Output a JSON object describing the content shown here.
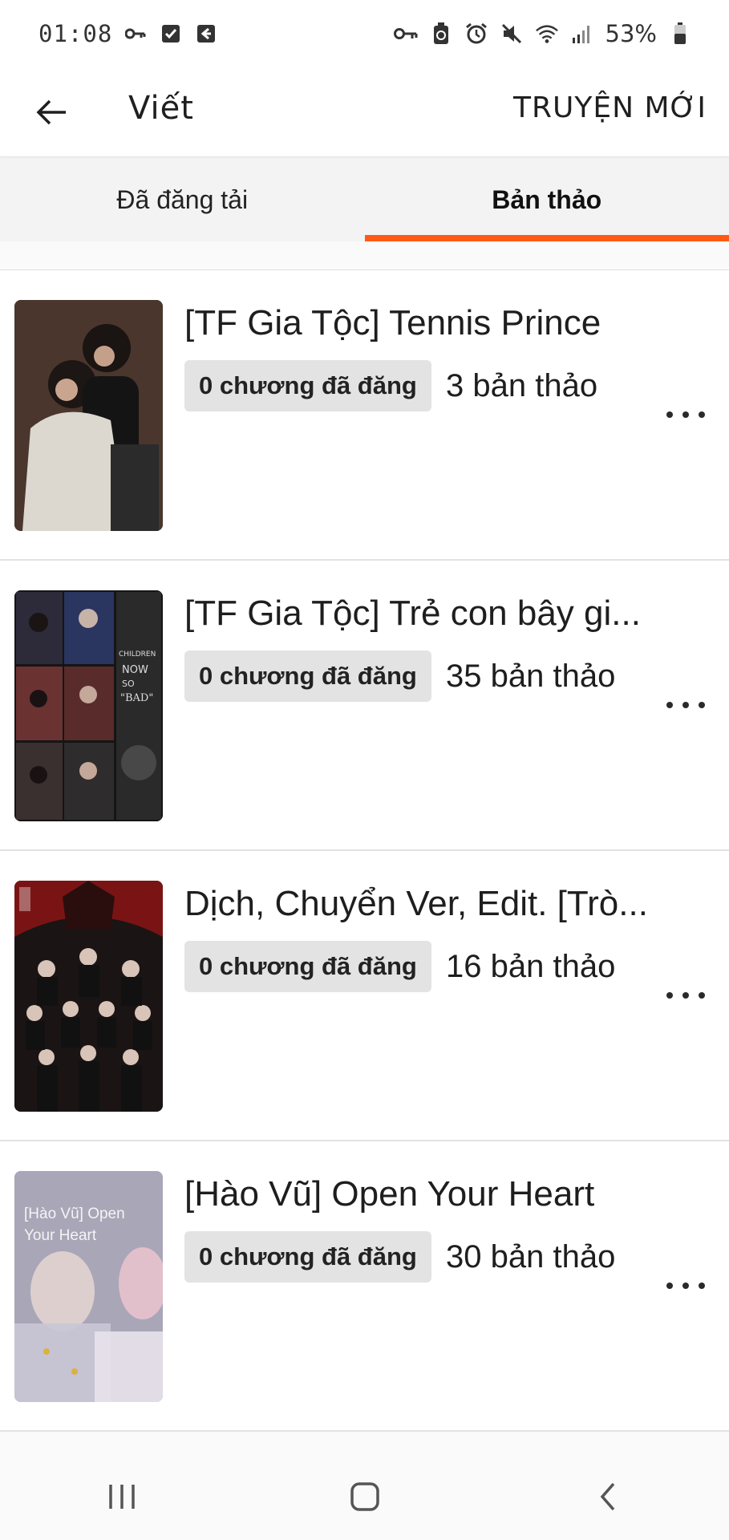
{
  "status_bar": {
    "time": "01:08",
    "battery": "53%",
    "icons": [
      "key-icon",
      "checkbox-icon",
      "return-box-icon",
      "vpn-key-icon",
      "recycle-icon",
      "alarm-icon",
      "mute-icon",
      "wifi-icon",
      "signal-icon",
      "battery-icon"
    ]
  },
  "header": {
    "title": "Viết",
    "new_story_label": "TRUYỆN MỚI"
  },
  "tabs": [
    {
      "label": "Đã đăng tải",
      "active": false
    },
    {
      "label": "Bản thảo",
      "active": true
    }
  ],
  "colors": {
    "accent": "#ff5a14",
    "badge_bg": "#e3e3e3"
  },
  "stories": [
    {
      "title": "[TF Gia Tộc] Tennis Prince",
      "published": "0 chương đã đăng",
      "drafts": "3 bản thảo"
    },
    {
      "title": "[TF Gia Tộc] Trẻ con bây gi...",
      "published": "0 chương đã đăng",
      "drafts": "35 bản thảo",
      "cover_text": [
        "CHILDREN",
        "NOW",
        "SO",
        "\"BAD\""
      ]
    },
    {
      "title": "Dịch, Chuyển Ver, Edit. [Trò...",
      "published": "0 chương đã đăng",
      "drafts": "16 bản thảo"
    },
    {
      "title": "[Hào Vũ] Open Your Heart",
      "published": "0 chương đã đăng",
      "drafts": "30 bản thảo",
      "cover_text": "[Hào Vũ] Open Your Heart"
    }
  ]
}
